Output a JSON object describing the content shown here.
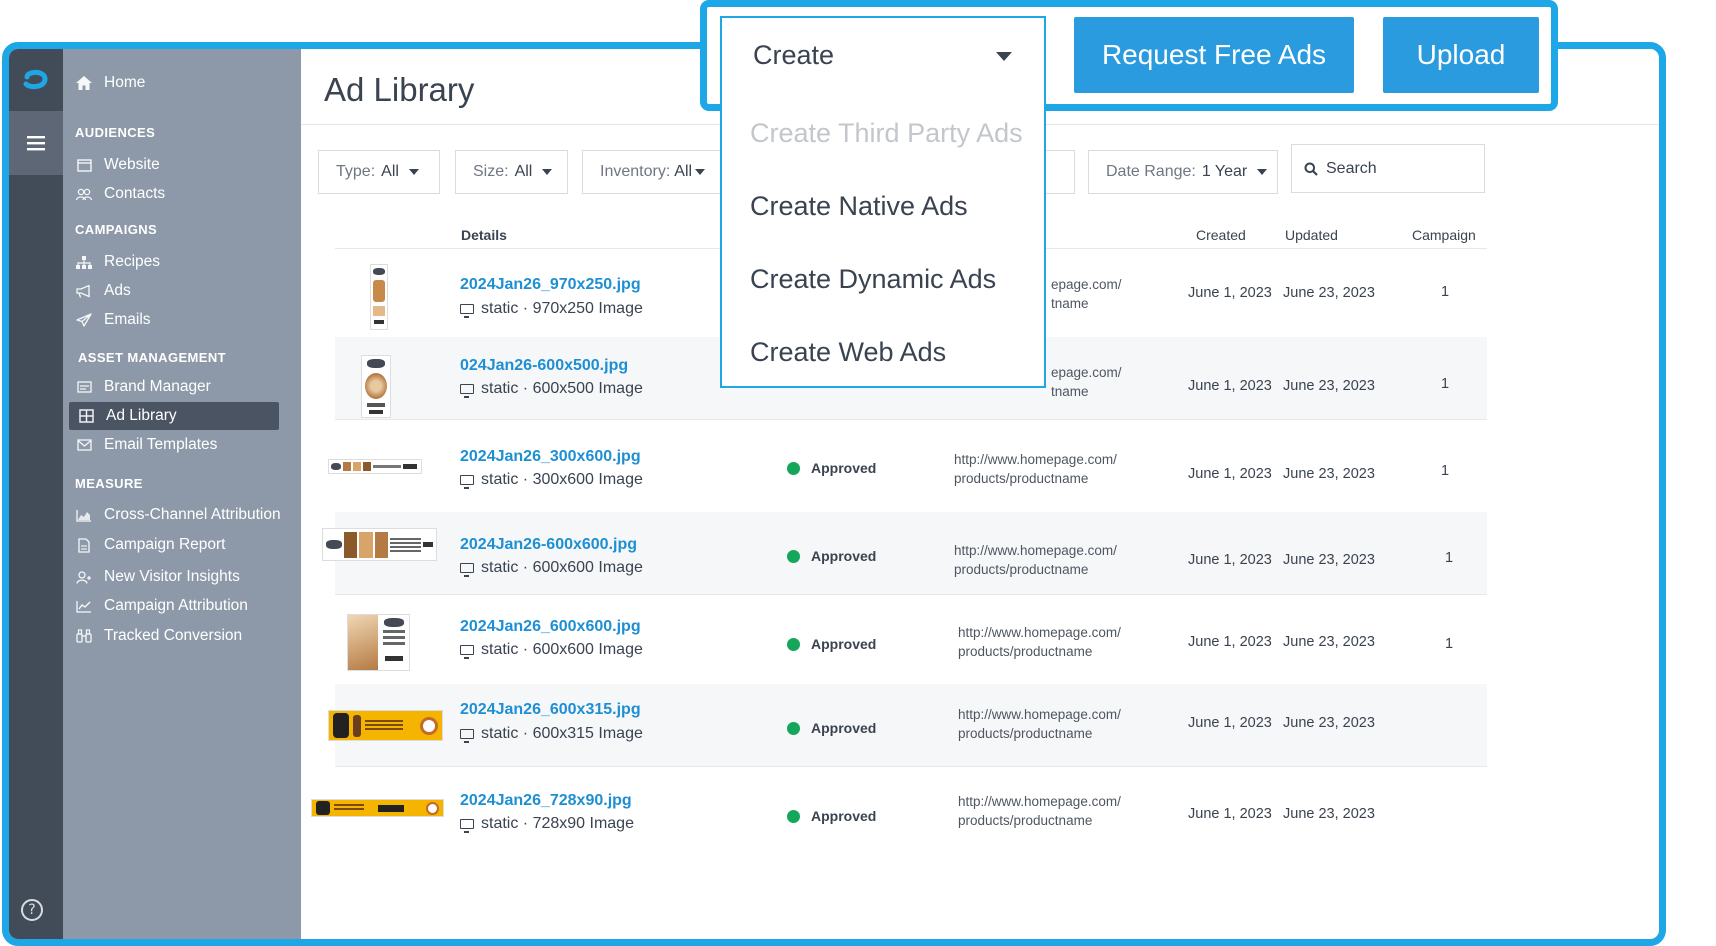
{
  "app": {
    "help_label": "?"
  },
  "sidebar": {
    "home": "Home",
    "sections": {
      "audiences": "AUDIENCES",
      "campaigns": "CAMPAIGNS",
      "asset_management": "ASSET MANAGEMENT",
      "measure": "MEASURE"
    },
    "items": {
      "website": "Website",
      "contacts": "Contacts",
      "recipes": "Recipes",
      "ads": "Ads",
      "emails": "Emails",
      "brand_manager": "Brand Manager",
      "ad_library": "Ad Library",
      "email_templates": "Email Templates",
      "cross_channel": "Cross-Channel Attribution",
      "campaign_report": "Campaign Report",
      "new_visitor": "New Visitor Insights",
      "campaign_attribution": "Campaign Attribution",
      "tracked_conversion": "Tracked Conversion"
    }
  },
  "main": {
    "title": "Ad Library",
    "filters": {
      "type_label": "Type:",
      "type_value": "All",
      "size_label": "Size:",
      "size_value": "All",
      "inventory_label": "Inventory:",
      "inventory_value": "All",
      "date_label": "Date Range:",
      "date_value": "1 Year"
    },
    "search_placeholder": "Search",
    "columns": {
      "details": "Details",
      "created": "Created",
      "updated": "Updated",
      "campaign": "Campaign"
    },
    "rows": [
      {
        "name": "2024Jan26_970x250.jpg",
        "meta": "static · 970x250 Image",
        "status": "",
        "url1": "epage.com/",
        "url2": "tname",
        "created": "June 1, 2023",
        "updated": "June 23, 2023",
        "campaign": "1"
      },
      {
        "name": "024Jan26-600x500.jpg",
        "meta": "static · 600x500 Image",
        "status": "",
        "url1": "epage.com/",
        "url2": "tname",
        "created": "June 1, 2023",
        "updated": "June 23, 2023",
        "campaign": "1"
      },
      {
        "name": "2024Jan26_300x600.jpg",
        "meta": "static · 300x600 Image",
        "status": "Approved",
        "url1": "http://www.homepage.com/",
        "url2": "products/productname",
        "created": "June 1, 2023",
        "updated": "June 23, 2023",
        "campaign": "1"
      },
      {
        "name": "2024Jan26-600x600.jpg",
        "meta": "static · 600x600 Image",
        "status": "Approved",
        "url1": "http://www.homepage.com/",
        "url2": "products/productname",
        "created": "June 1, 2023",
        "updated": "June 23, 2023",
        "campaign": "1"
      },
      {
        "name": "2024Jan26_600x600.jpg",
        "meta": "static · 600x600 Image",
        "status": "Approved",
        "url1": "http://www.homepage.com/",
        "url2": "products/productname",
        "created": "June 1, 2023",
        "updated": "June 23, 2023",
        "campaign": "1"
      },
      {
        "name": "2024Jan26_600x315.jpg",
        "meta": "static · 600x315 Image",
        "status": "Approved",
        "url1": "http://www.homepage.com/",
        "url2": "products/productname",
        "created": "June 1, 2023",
        "updated": "June 23, 2023",
        "campaign": ""
      },
      {
        "name": "2024Jan26_728x90.jpg",
        "meta": "static · 728x90 Image",
        "status": "Approved",
        "url1": "http://www.homepage.com/",
        "url2": "products/productname",
        "created": "June 1, 2023",
        "updated": "June 23, 2023",
        "campaign": ""
      }
    ]
  },
  "create_menu": {
    "label": "Create",
    "items": {
      "third_party": "Create Third Party Ads",
      "native": "Create Native Ads",
      "dynamic": "Create Dynamic Ads",
      "web": "Create Web Ads"
    }
  },
  "toolbar": {
    "request_free_ads": "Request Free Ads",
    "upload": "Upload"
  },
  "colors": {
    "accent": "#1da7e6",
    "button": "#2b9be0",
    "link": "#1e8fd3",
    "approved": "#14a65a",
    "sidebar": "#8d99a8",
    "rail": "#424c59"
  }
}
